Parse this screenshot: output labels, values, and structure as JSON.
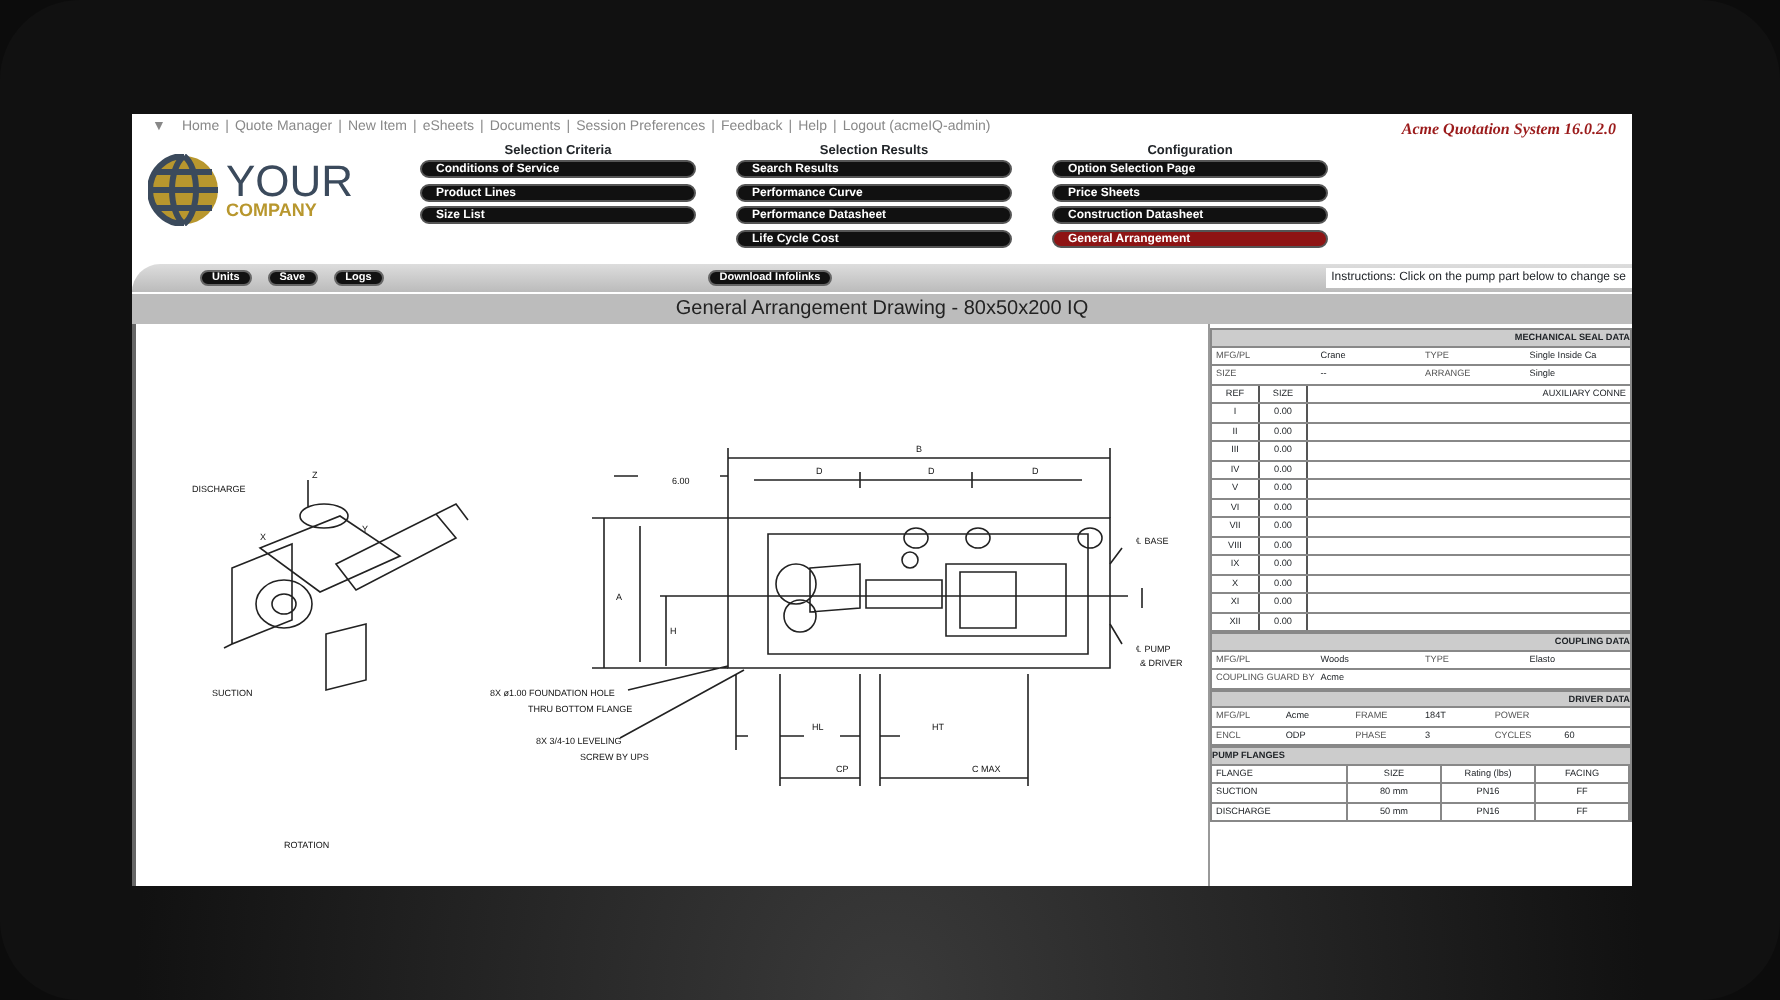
{
  "nav": {
    "toggle": "▼",
    "separator": "|",
    "links": [
      "Home",
      "Quote Manager",
      "New Item",
      "eSheets",
      "Documents",
      "Session Preferences",
      "Feedback",
      "Help",
      "Logout (acmeIQ-admin)"
    ]
  },
  "app_version": "Acme Quotation System 16.0.2.0",
  "logo": {
    "line1": "YOUR",
    "line2": "COMPANY"
  },
  "menu_groups": [
    {
      "heading": "Selection Criteria",
      "items": [
        {
          "label": "Conditions of Service",
          "selected": false
        },
        {
          "label": "Product Lines",
          "selected": false
        },
        {
          "label": "Size List",
          "selected": false
        }
      ]
    },
    {
      "heading": "Selection Results",
      "items": [
        {
          "label": "Search Results",
          "selected": false
        },
        {
          "label": "Performance Curve",
          "selected": false
        },
        {
          "label": "Performance Datasheet",
          "selected": false
        },
        {
          "label": "Life Cycle Cost",
          "selected": false
        }
      ]
    },
    {
      "heading": "Configuration",
      "items": [
        {
          "label": "Option Selection Page",
          "selected": false
        },
        {
          "label": "Price Sheets",
          "selected": false
        },
        {
          "label": "Construction Datasheet",
          "selected": false
        },
        {
          "label": "General Arrangement",
          "selected": true
        }
      ]
    }
  ],
  "toolbar": {
    "buttons": [
      "Units",
      "Save",
      "Logs"
    ],
    "download": "Download Infolinks",
    "instructions": "Instructions:  Click on the pump part below to change se"
  },
  "drawing_title": "General Arrangement Drawing - 80x50x200 IQ",
  "drawing": {
    "labels": [
      "DISCHARGE",
      "SUCTION",
      "Z",
      "X",
      "Y",
      "6.00",
      "B",
      "D",
      "D",
      "D",
      "A",
      "H",
      "8X ø1.00 FOUNDATION HOLE",
      "THRU BOTTOM FLANGE",
      "8X 3/4-10 LEVELING",
      "SCREW BY UPS",
      "HL",
      "HT",
      "CP",
      "C MAX",
      "℄ BASE",
      "℄ PUMP",
      "& DRIVER",
      "ROTATION"
    ]
  },
  "data_sheet": {
    "sections": [
      {
        "kind": "fields",
        "title": "MECHANICAL SEAL DATA",
        "rows": [
          [
            "MFG/PL",
            "Crane",
            "TYPE",
            "Single Inside Ca"
          ],
          [
            "SIZE",
            "--",
            "ARRANGE",
            "Single"
          ]
        ]
      },
      {
        "kind": "aux",
        "header": [
          "REF",
          "SIZE",
          "AUXILIARY CONNE"
        ],
        "rows": [
          [
            "I",
            "0.00",
            ""
          ],
          [
            "II",
            "0.00",
            ""
          ],
          [
            "III",
            "0.00",
            ""
          ],
          [
            "IV",
            "0.00",
            ""
          ],
          [
            "V",
            "0.00",
            ""
          ],
          [
            "VI",
            "0.00",
            ""
          ],
          [
            "VII",
            "0.00",
            ""
          ],
          [
            "VIII",
            "0.00",
            ""
          ],
          [
            "IX",
            "0.00",
            ""
          ],
          [
            "X",
            "0.00",
            ""
          ],
          [
            "XI",
            "0.00",
            ""
          ],
          [
            "XII",
            "0.00",
            ""
          ]
        ]
      },
      {
        "kind": "fields",
        "title": "COUPLING DATA",
        "rows": [
          [
            "MFG/PL",
            "Woods",
            "TYPE",
            "Elasto"
          ],
          [
            "COUPLING GUARD BY",
            "Acme",
            "",
            ""
          ]
        ]
      },
      {
        "kind": "fields",
        "title": "DRIVER DATA",
        "rows": [
          [
            "MFG/PL",
            "Acme",
            "FRAME",
            "184T",
            "POWER",
            ""
          ],
          [
            "ENCL",
            "ODP",
            "PHASE",
            "3",
            "CYCLES",
            "60"
          ]
        ]
      },
      {
        "kind": "table",
        "title": "PUMP FLANGES",
        "header": [
          "FLANGE",
          "SIZE",
          "Rating (lbs)",
          "FACING"
        ],
        "rows": [
          [
            "SUCTION",
            "80 mm",
            "PN16",
            "FF"
          ],
          [
            "DISCHARGE",
            "50 mm",
            "PN16",
            "FF"
          ]
        ]
      }
    ]
  }
}
